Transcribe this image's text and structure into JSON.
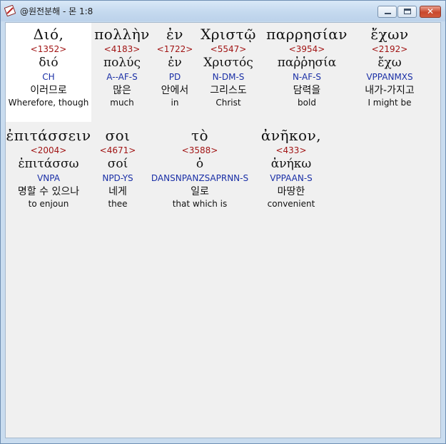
{
  "window": {
    "title": "@원전분해 - 몬 1:8"
  },
  "controls": {
    "minimize": "",
    "maximize": "",
    "close": "✕"
  },
  "rows": [
    [
      {
        "greek": "Διό,",
        "strong": "<1352>",
        "lemma": "διό",
        "parse": "CH",
        "korean": "이러므로",
        "english": "Wherefore, though"
      },
      {
        "greek": "πολλὴν",
        "strong": "<4183>",
        "lemma": "πολύς",
        "parse": "A--AF-S",
        "korean": "많은",
        "english": "much"
      },
      {
        "greek": "ἐν",
        "strong": "<1722>",
        "lemma": "ἐν",
        "parse": "PD",
        "korean": "안에서",
        "english": "in"
      },
      {
        "greek": "Χριστῷ",
        "strong": "<5547>",
        "lemma": "Χριστός",
        "parse": "N-DM-S",
        "korean": "그리스도",
        "english": "Christ"
      },
      {
        "greek": "παρρησίαν",
        "strong": "<3954>",
        "lemma": "παῤῥησία",
        "parse": "N-AF-S",
        "korean": "담력을",
        "english": "bold"
      },
      {
        "greek": "ἔχων",
        "strong": "<2192>",
        "lemma": "ἔχω",
        "parse": "VPPANMXS",
        "korean": "내가-가지고",
        "english": "I might be"
      }
    ],
    [
      {
        "greek": "ἐπιτάσσειν",
        "strong": "<2004>",
        "lemma": "ἐπιτάσσω",
        "parse": "VNPA",
        "korean": "명할 수 있으나",
        "english": "to enjoun"
      },
      {
        "greek": "σοι",
        "strong": "<4671>",
        "lemma": "σοί",
        "parse": "NPD-YS",
        "korean": "네게",
        "english": "thee"
      },
      {
        "greek": "τὸ",
        "strong": "<3588>",
        "lemma": "ὁ",
        "parse": "DANSNPANZSAPRNN-S",
        "korean": "일로",
        "english": "that which is"
      },
      {
        "greek": "ἀνῆκον,",
        "strong": "<433>",
        "lemma": "ἀνήκω",
        "parse": "VPPAAN-S",
        "korean": "마땅한",
        "english": "convenient"
      }
    ]
  ]
}
